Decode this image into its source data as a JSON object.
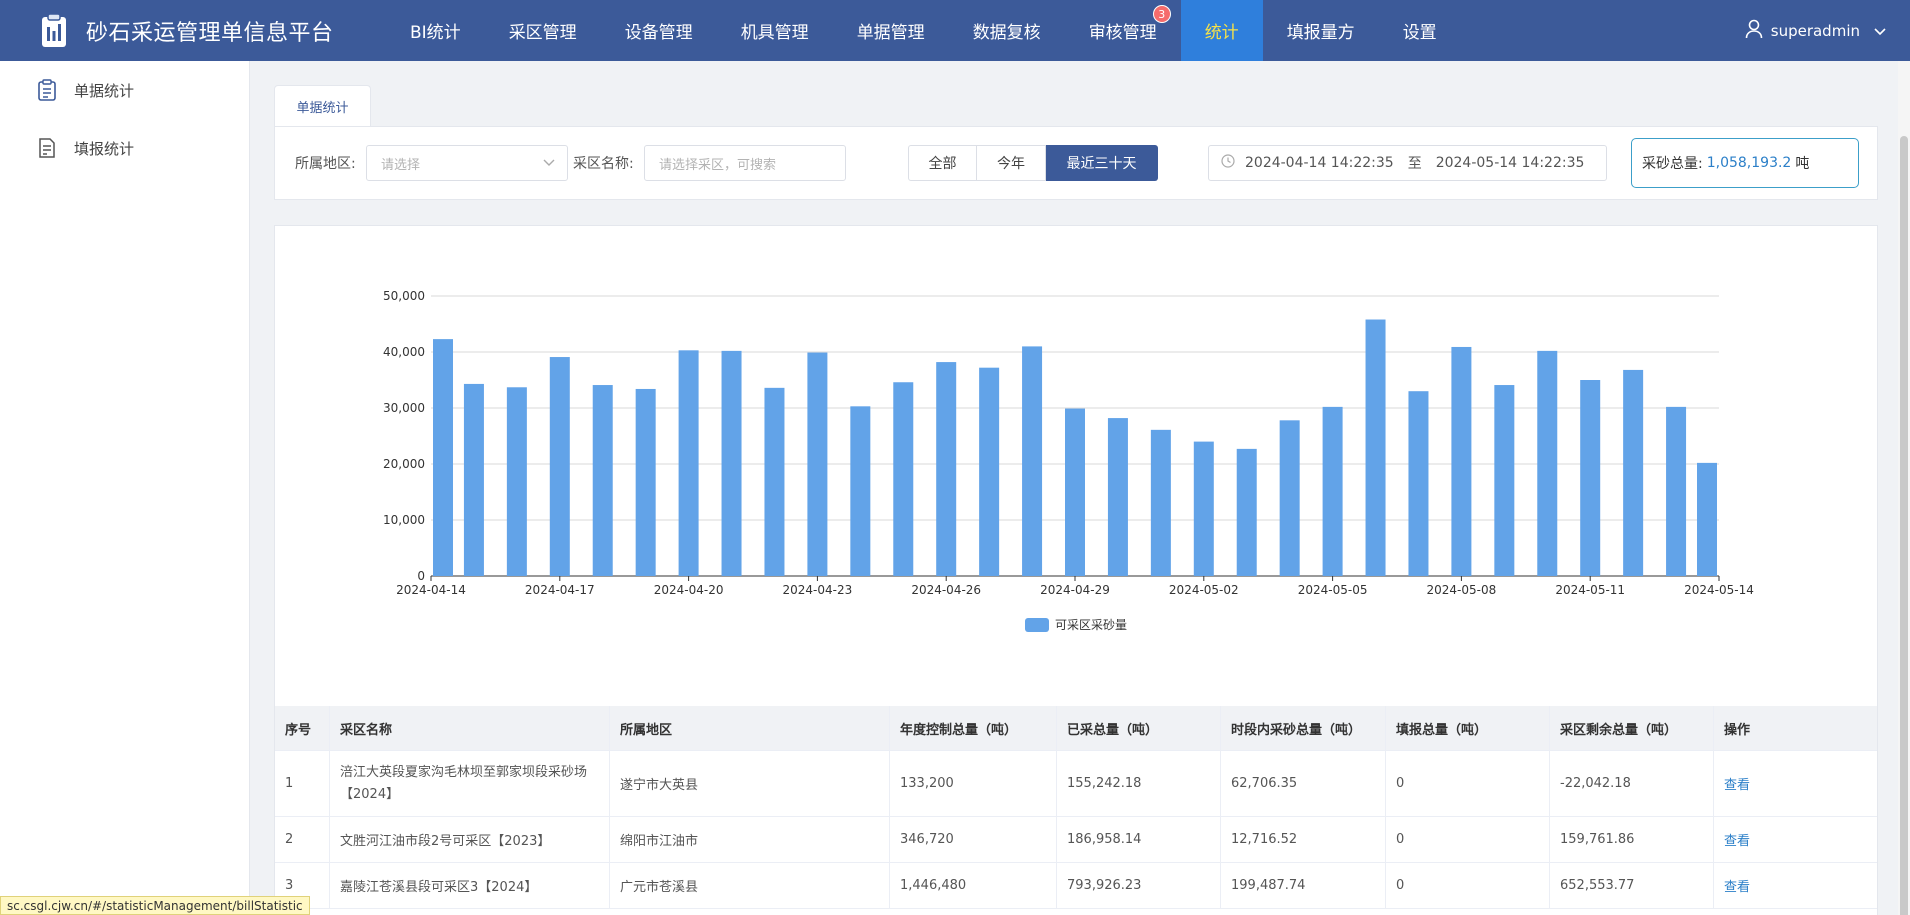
{
  "app": {
    "title": "砂石采运管理单信息平台",
    "brand_color": "#3c5a99"
  },
  "nav": {
    "items": [
      {
        "label": "BI统计"
      },
      {
        "label": "采区管理"
      },
      {
        "label": "设备管理"
      },
      {
        "label": "机具管理"
      },
      {
        "label": "单据管理"
      },
      {
        "label": "数据复核"
      },
      {
        "label": "审核管理",
        "badge": "3"
      },
      {
        "label": "统计",
        "active": true
      },
      {
        "label": "填报量方"
      },
      {
        "label": "设置"
      }
    ]
  },
  "user": {
    "name": "superadmin"
  },
  "sidebar": {
    "items": [
      {
        "label": "单据统计",
        "icon": "clipboard-icon"
      },
      {
        "label": "填报统计",
        "icon": "document-icon"
      }
    ]
  },
  "filters": {
    "tab_label": "单据统计",
    "region_label": "所属地区:",
    "region_placeholder": "请选择",
    "area_label": "采区名称:",
    "area_placeholder": "请选择采区，可搜索",
    "segment": {
      "all": "全部",
      "this_year": "今年",
      "last_30": "最近三十天"
    },
    "date_start": "2024-04-14 14:22:35",
    "date_sep": "至",
    "date_end": "2024-05-14 14:22:35",
    "total_label": "采砂总量:",
    "total_value": "1,058,193.2",
    "total_unit": "吨"
  },
  "chart_data": {
    "type": "bar",
    "categories": [
      "2024-04-14",
      "2024-04-15",
      "2024-04-16",
      "2024-04-17",
      "2024-04-18",
      "2024-04-19",
      "2024-04-20",
      "2024-04-21",
      "2024-04-22",
      "2024-04-23",
      "2024-04-24",
      "2024-04-25",
      "2024-04-26",
      "2024-04-27",
      "2024-04-28",
      "2024-04-29",
      "2024-04-30",
      "2024-05-01",
      "2024-05-02",
      "2024-05-03",
      "2024-05-04",
      "2024-05-05",
      "2024-05-06",
      "2024-05-07",
      "2024-05-08",
      "2024-05-09",
      "2024-05-10",
      "2024-05-11",
      "2024-05-12",
      "2024-05-13",
      "2024-05-14"
    ],
    "x_tick_labels": [
      "2024-04-14",
      "2024-04-17",
      "2024-04-20",
      "2024-04-23",
      "2024-04-26",
      "2024-04-29",
      "2024-05-02",
      "2024-05-05",
      "2024-05-08",
      "2024-05-11",
      "2024-05-14"
    ],
    "series": [
      {
        "name": "可采区采砂量",
        "values": [
          42300,
          34300,
          33700,
          39100,
          34100,
          33400,
          40300,
          40200,
          33600,
          39900,
          30300,
          34600,
          38200,
          37200,
          41000,
          29900,
          28200,
          26100,
          24000,
          22700,
          27800,
          30200,
          45800,
          33000,
          40900,
          34100,
          40200,
          35000,
          36800,
          30200,
          20200
        ]
      }
    ],
    "ylim": [
      0,
      50000
    ],
    "y_ticks": [
      "0",
      "10,000",
      "20,000",
      "30,000",
      "40,000",
      "50,000"
    ],
    "grid": true,
    "legend_position": "bottom-center",
    "bar_color": "#62a3e8"
  },
  "table": {
    "headers": [
      "序号",
      "采区名称",
      "所属地区",
      "年度控制总量（吨）",
      "已采总量（吨）",
      "时段内采砂总量（吨）",
      "填报总量（吨）",
      "采区剩余总量（吨）",
      "操作"
    ],
    "rows": [
      [
        "1",
        "涪江大英段夏家沟毛林坝至郭家坝段采砂场【2024】",
        "遂宁市大英县",
        "133,200",
        "155,242.18",
        "62,706.35",
        "0",
        "-22,042.18",
        "查看"
      ],
      [
        "2",
        "文胜河江油市段2号可采区【2023】",
        "绵阳市江油市",
        "346,720",
        "186,958.14",
        "12,716.52",
        "0",
        "159,761.86",
        "查看"
      ],
      [
        "3",
        "嘉陵江苍溪县段可采区3【2024】",
        "广元市苍溪县",
        "1,446,480",
        "793,926.23",
        "199,487.74",
        "0",
        "652,553.77",
        "查看"
      ]
    ]
  },
  "status_url": "sc.csgl.cjw.cn/#/statisticManagement/billStatistic"
}
